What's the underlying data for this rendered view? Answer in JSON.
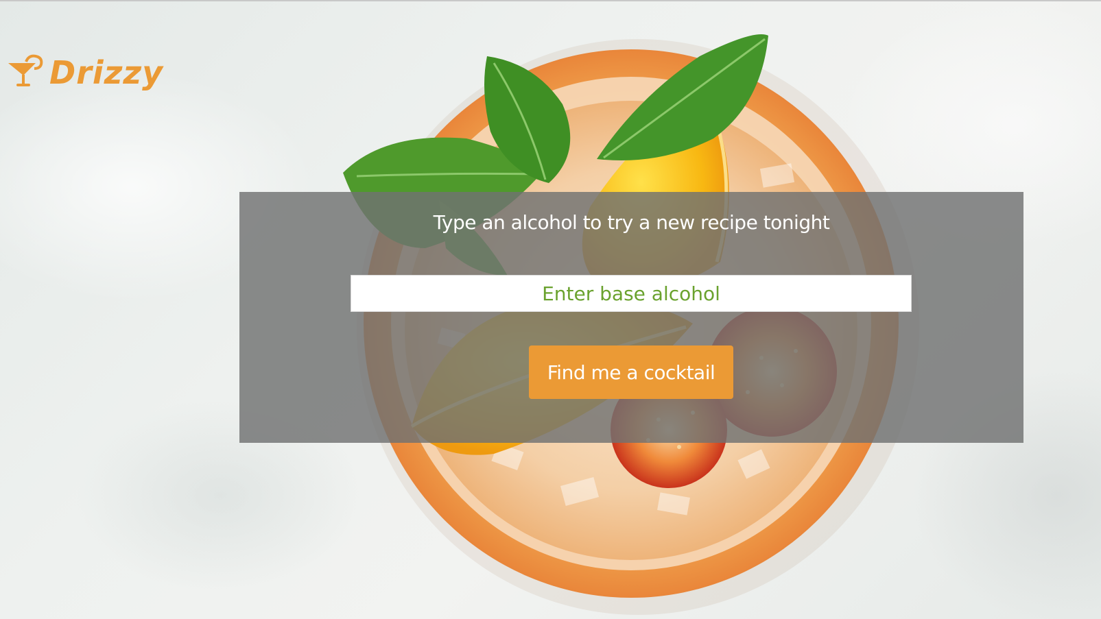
{
  "brand": {
    "name": "Drizzy",
    "logo_icon": "cocktail-glass-icon",
    "color": "#eb9a35"
  },
  "search": {
    "heading": "Type an alcohol to try a new recipe tonight",
    "placeholder": "Enter base alcohol",
    "value": "",
    "button_label": "Find me a cocktail",
    "placeholder_color": "#6aa22e",
    "button_color": "#eb9a35"
  },
  "background": {
    "subject": "cocktail-photo"
  }
}
